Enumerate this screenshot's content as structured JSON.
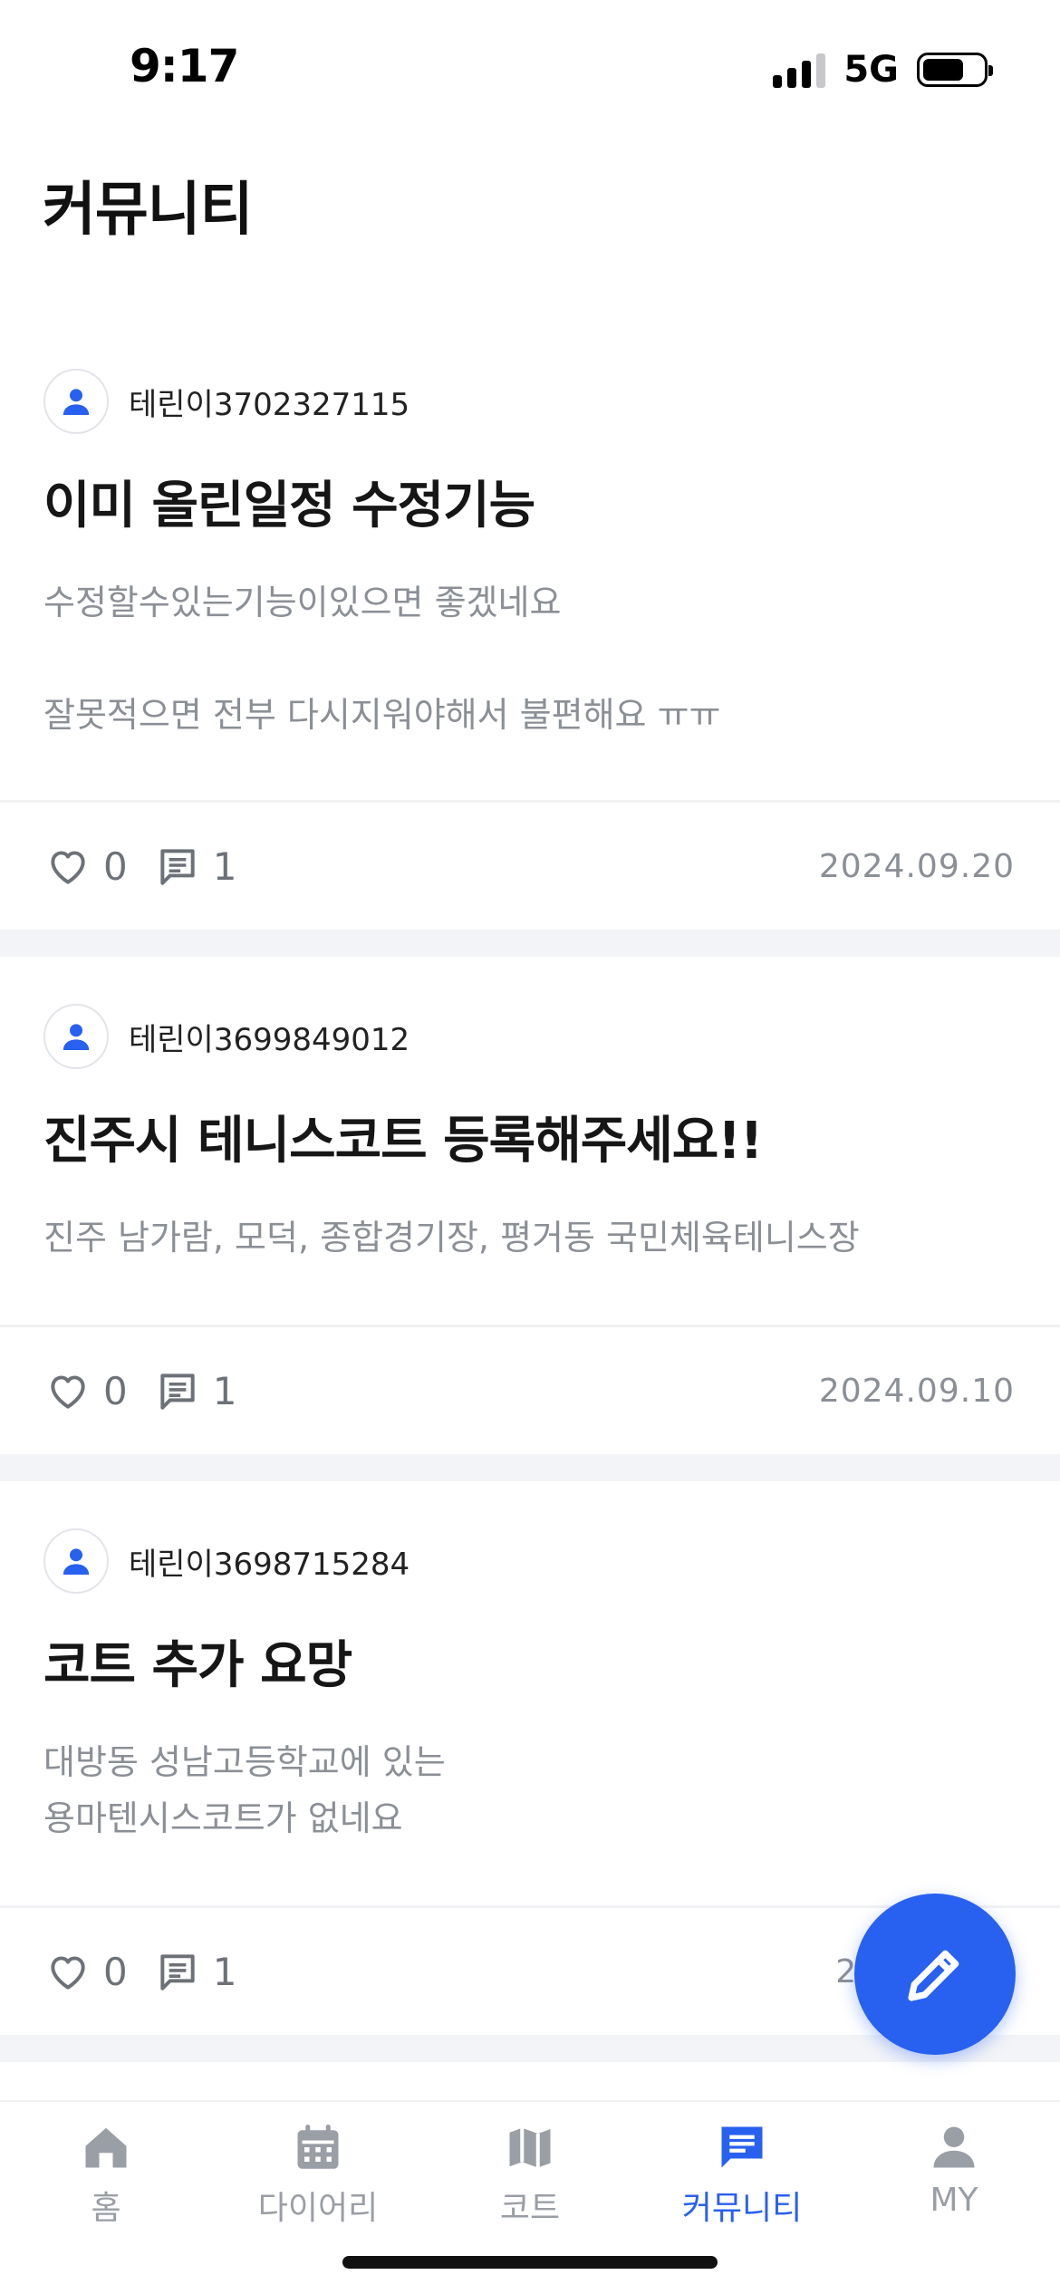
{
  "status_bar": {
    "time": "9:17",
    "network": "5G"
  },
  "header": {
    "title": "커뮤니티"
  },
  "posts": [
    {
      "author": "테린이3702327115",
      "title": "이미 올린일정 수정기능",
      "body": "수정할수있는기능이있으면 좋겠네요\n\n잘못적으면 전부 다시지워야해서 불편해요 ㅠㅠ",
      "likes": "0",
      "comments": "1",
      "date": "2024.09.20"
    },
    {
      "author": "테린이3699849012",
      "title": "진주시 테니스코트 등록해주세요!!",
      "body": "진주 남가람, 모덕, 종합경기장, 평거동 국민체육테니스장",
      "likes": "0",
      "comments": "1",
      "date": "2024.09.10"
    },
    {
      "author": "테린이3698715284",
      "title": "코트 추가 요망",
      "body": "대방동 성남고등학교에 있는\n용마텐시스코트가 없네요",
      "likes": "0",
      "comments": "1",
      "date": "20"
    }
  ],
  "tab_bar": {
    "tabs": [
      {
        "label": "홈",
        "icon": "home-icon"
      },
      {
        "label": "다이어리",
        "icon": "calendar-icon"
      },
      {
        "label": "코트",
        "icon": "map-icon"
      },
      {
        "label": "커뮤니티",
        "icon": "chat-icon",
        "active": true
      },
      {
        "label": "MY",
        "icon": "person-icon"
      }
    ]
  },
  "colors": {
    "accent": "#2860f0",
    "muted_text": "#8b8f96",
    "inactive_tab": "#9a9ea5",
    "separator": "#f3f4f7"
  }
}
